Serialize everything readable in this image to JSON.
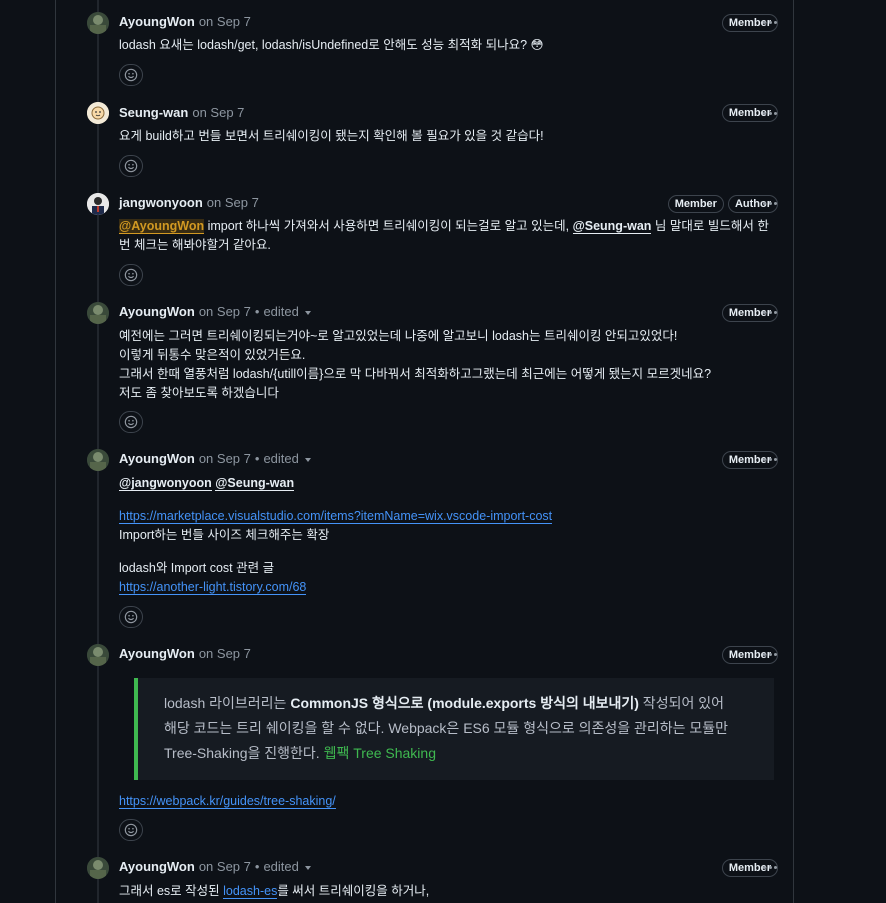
{
  "comments": [
    {
      "author": "AyoungWon",
      "date": "on Sep 7",
      "badges": [
        "Member"
      ],
      "text": "lodash 요새는 lodash/get, lodash/isUndefined로 안해도 성능 최적화 되나요? 😳"
    },
    {
      "author": "Seung-wan",
      "date": "on Sep 7",
      "badges": [
        "Member"
      ],
      "text": "요게 build하고 번들 보면서 트리쉐이킹이 됐는지 확인해 볼 필요가 있을 것 같습다!"
    },
    {
      "author": "jangwonyoon",
      "date": "on Sep 7",
      "badges": [
        "Member",
        "Author"
      ],
      "mention1": "@AyoungWon",
      "text_a": " import 하나씩 가져와서 사용하면 트리쉐이킹이 되는걸로 알고 있는데, ",
      "mention2": "@Seung-wan",
      "text_b": " 님 말대로 빌드해서 한번 체크는 해봐야할거 같아요."
    },
    {
      "author": "AyoungWon",
      "date": "on Sep 7",
      "edited": "edited",
      "badges": [
        "Member"
      ],
      "lines": [
        "예전에는 그러면 트리쉐이킹되는거야~로 알고있었는데 나중에 알고보니 lodash는 트리쉐이킹 안되고있었다!",
        "이렇게 뒤통수 맞은적이 있었거든요.",
        "그래서 한때 열풍처럼 lodash/{utill이름}으로 막 다바꿔서 최적화하고그랬는데 최근에는 어떻게 됐는지 모르겟네요?",
        "저도 좀 찾아보도록 하겠습니다"
      ]
    },
    {
      "author": "AyoungWon",
      "date": "on Sep 7",
      "edited": "edited",
      "badges": [
        "Member"
      ],
      "mention1": "@jangwonyoon",
      "mention2": "@Seung-wan",
      "link1": "https://marketplace.visualstudio.com/items?itemName=wix.vscode-import-cost",
      "line1": "Import하는 번들 사이즈 체크해주는 확장",
      "line2": "lodash와 Import cost 관련 글",
      "link2": "https://another-light.tistory.com/68"
    },
    {
      "author": "AyoungWon",
      "date": "on Sep 7",
      "badges": [
        "Member"
      ],
      "quote": {
        "q1_a": "lodash 라이브러리는 ",
        "q1_b": "CommonJS 형식으로 (module.exports 방식의 내보내기)",
        "q1_c": " 작성되어 있어",
        "q2": "해당 코드는 트리 쉐이킹을 할 수 없다. Webpack은 ES6 모듈 형식으로 의존성을 관리하는 모듈만",
        "q3_a": "Tree-Shaking을 진행한다. ",
        "q3_b": "웹팩 Tree Shaking"
      },
      "link": "https://webpack.kr/guides/tree-shaking/"
    },
    {
      "author": "AyoungWon",
      "date": "on Sep 7",
      "edited": "edited",
      "badges": [
        "Member"
      ],
      "text_a": "그래서 es로 작성된 ",
      "link": "lodash-es",
      "text_b": "를 써서 트리쉐이킹을 하거나,"
    }
  ],
  "colors": {
    "background": "#0d1117",
    "link": "#4493f8",
    "muted": "#8d96a0",
    "quote_accent": "#3fb950",
    "mention_highlight": "#d29922"
  },
  "icons": [
    "smiley-icon",
    "kebab-icon",
    "caret-down-icon"
  ]
}
